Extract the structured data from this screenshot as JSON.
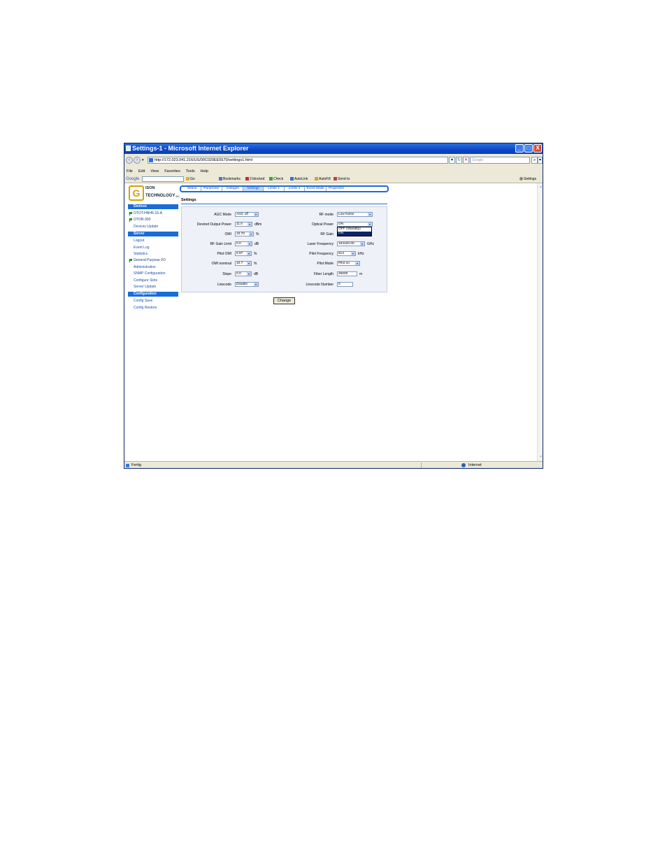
{
  "window": {
    "title": "Settings-1 - Microsoft Internet Explorer",
    "controls": {
      "minimize": "_",
      "maximize": "□",
      "close": "X"
    }
  },
  "address": {
    "url": "http://172.023.041.216/US/00C020EE5570/settings1.html",
    "search_placeholder": "Google"
  },
  "menu": [
    "File",
    "Edit",
    "View",
    "Favorites",
    "Tools",
    "Help"
  ],
  "google_bar": {
    "brand": "Google",
    "go": "Go",
    "bookmarks": "Bookmarks",
    "blocked": "3 blocked",
    "check": "Check",
    "autolink": "AutoLink",
    "autofill": "AutoFill",
    "send_to": "Send to",
    "settings": "Settings"
  },
  "logo": {
    "line1": "ISON",
    "line2": "TECHNOLOGY",
    "suffix": "INC",
    "letter": "G"
  },
  "sidebar": {
    "devices_header": "Devices",
    "devices": [
      "OTOT-HNH6-15-A",
      "OTOR-300"
    ],
    "devices_update": "Devices Update",
    "server_header": "Server",
    "server_items": [
      "Logout",
      "Event Log",
      "Statistics",
      "General Purpose I/O",
      "Administration",
      "SNMP Configuration",
      "Configure Slots",
      "Server Update"
    ],
    "config_header": "Configuration",
    "config_items": [
      "Config Save",
      "Config Restore"
    ]
  },
  "tabs": [
    "Status",
    "Parameter",
    "Voltages",
    "Settings",
    "Limits 1",
    "Limits 2",
    "Event Mask",
    "Properties"
  ],
  "active_tab": "Settings",
  "page_title": "Settings",
  "settings": {
    "agc_mode": {
      "label": "AGC Mode",
      "value": "AGC off"
    },
    "desired_output_power": {
      "label": "Desired Output Power",
      "value": "11.0",
      "unit": "dBm"
    },
    "omi": {
      "label": "OMI",
      "value": "10.70",
      "unit": "%"
    },
    "rf_gain_limit": {
      "label": "RF Gain Limit",
      "value": "0.0",
      "unit": "dB"
    },
    "pilot_omi": {
      "label": "Pilot OMI",
      "value": "5.87",
      "unit": "%"
    },
    "omi_nominal": {
      "label": "OMI nominal",
      "value": "10.7",
      "unit": "%"
    },
    "slope": {
      "label": "Slope",
      "value": "0.0",
      "unit": "dB"
    },
    "linecode": {
      "label": "Linecode",
      "value": "Disable"
    },
    "rf_mode": {
      "label": "RF mode",
      "value": "Low Noise"
    },
    "optical_power": {
      "label": "Optical Power",
      "value": "ON",
      "options": [
        "OFF (Standby)",
        "ON"
      ]
    },
    "rf_gain": {
      "label": "RF Gain"
    },
    "laser_frequency": {
      "label": "Laser Frequency",
      "value": "194100.00",
      "unit": "GHz"
    },
    "pilot_frequency": {
      "label": "Pilot Frequency",
      "value": "614",
      "unit": "kHz"
    },
    "pilot_mode": {
      "label": "Pilot Mode",
      "value": "Pilot on"
    },
    "fiber_length": {
      "label": "Fiber Length",
      "value": "25000",
      "unit": "m"
    },
    "linecode_number": {
      "label": "Linecode Number",
      "value": "0"
    }
  },
  "change_button": "Change",
  "status": {
    "left": "Fertig",
    "zone": "Internet"
  }
}
